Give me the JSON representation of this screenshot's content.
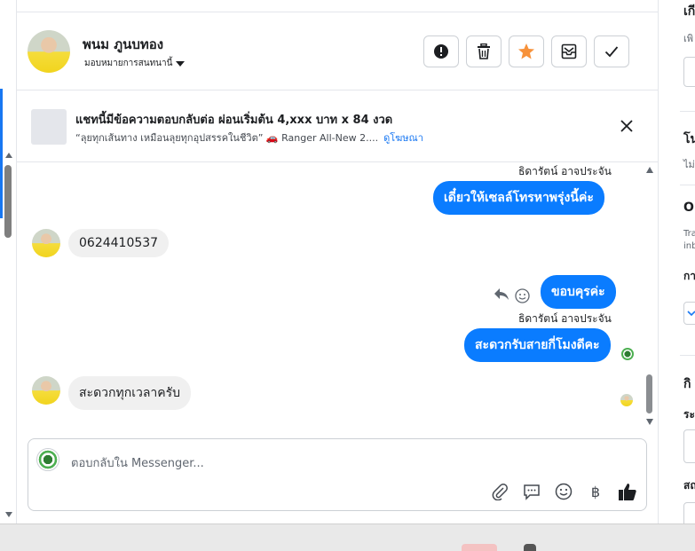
{
  "header": {
    "contact_name": "พนม ภูนบทอง",
    "assign_label": "มอบหมายการสนทนานี้",
    "actions": [
      {
        "icon": "alert-icon",
        "name": "mark-spam-button"
      },
      {
        "icon": "trash-icon",
        "name": "delete-button"
      },
      {
        "icon": "star-icon",
        "name": "star-button"
      },
      {
        "icon": "mark-unread-icon",
        "name": "mark-unread-button"
      },
      {
        "icon": "check-icon",
        "name": "mark-done-button"
      }
    ],
    "star_color": "#f7923b"
  },
  "ad": {
    "title": "แชทนี้มีข้อความตอบกลับต่อ ผ่อนเริ่มต้น 4,xxx บาท x 84 งวด",
    "subtitle": "“ลุยทุกเส้นทาง เหมือนลุยทุกอุปสรรคในชีวิต” 🚗 Ranger All-New 2....",
    "link": "ดูโฆษณา"
  },
  "messages": {
    "sender_1": "ธิดารัตน์ อาจประจัน",
    "out_1": "เดี๋ยวให้เซลล์โทรหาพรุ่งนี้ค่ะ",
    "in_1": "0624410537",
    "out_2": "ขอบคุรค่ะ",
    "sender_2": "ธิดารัตน์ อาจประจัน",
    "out_3": "สะดวกรับสายกี่โมงดีคะ",
    "in_2": "สะดวกทุกเวลาครับ"
  },
  "composer": {
    "placeholder": "ตอบกลับใน Messenger...",
    "tools": [
      "attach-icon",
      "saved-reply-icon",
      "emoji-icon",
      "baht-icon",
      "thumbs-up-icon"
    ]
  },
  "right_panel": {
    "title_1": "เกี",
    "sub_1": "เพิ",
    "title_2": "โน",
    "sub_2": "ไม่",
    "title_3": "Or",
    "sub_3a": "Tra",
    "sub_3b": "inb",
    "label_3": "กา",
    "title_4": "กิ",
    "label_4": "ระ",
    "label_5": "สถ"
  },
  "colors": {
    "bubble_out": "#0a7cff",
    "bubble_in": "#f0f0f0",
    "link": "#1877f2"
  }
}
